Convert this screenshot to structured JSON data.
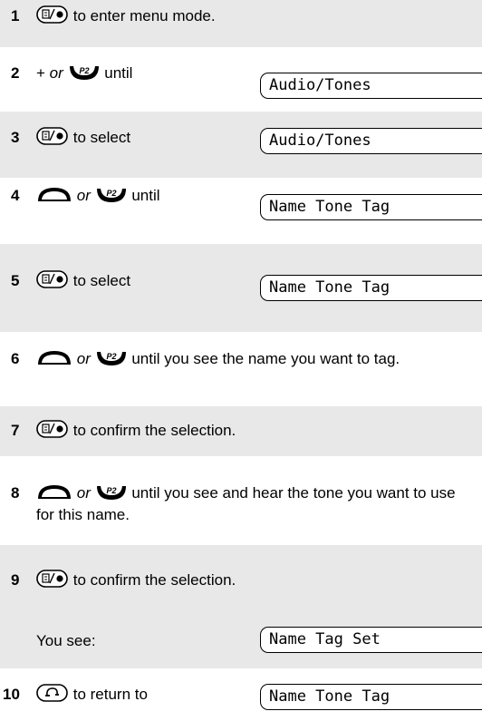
{
  "steps": [
    {
      "number": "1",
      "after": "to enter menu mode."
    },
    {
      "number": "2",
      "before": "+",
      "or": "or",
      "after": "until",
      "display": "Audio/Tones"
    },
    {
      "number": "3",
      "after": "to select",
      "display": "Audio/Tones"
    },
    {
      "number": "4",
      "or": "or",
      "after": "until",
      "display": "Name Tone Tag"
    },
    {
      "number": "5",
      "after": "to select",
      "display": "Name Tone Tag"
    },
    {
      "number": "6",
      "or": "or",
      "after": "until you see the name you want to tag."
    },
    {
      "number": "7",
      "after": "to confirm the selection."
    },
    {
      "number": "8",
      "or": "or",
      "after": "until you see and hear the tone you want to use for this name."
    },
    {
      "number": "9",
      "after": "to confirm the selection."
    },
    {
      "label": "You see:",
      "display": "Name Tag Set"
    },
    {
      "number": "10",
      "after": "to return to",
      "display": "Name Tone Tag"
    }
  ],
  "icons": {
    "menu": "menu-select-key-icon",
    "up": "up-arc-key-icon",
    "down": "p2-down-key-icon",
    "end": "end-key-icon"
  },
  "colors": {
    "shade": "#e8e8e8",
    "text": "#000000"
  }
}
